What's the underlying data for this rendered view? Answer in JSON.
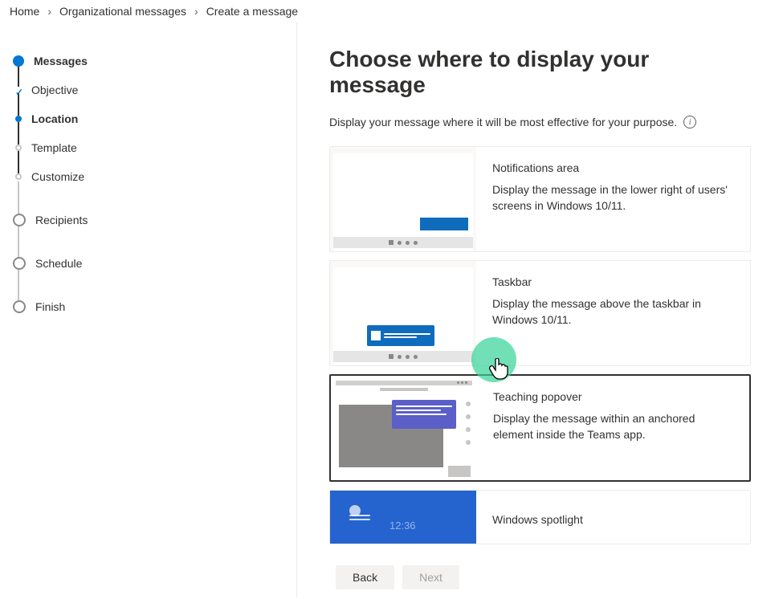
{
  "breadcrumb": {
    "items": [
      {
        "label": "Home"
      },
      {
        "label": "Organizational messages"
      },
      {
        "label": "Create a message"
      }
    ]
  },
  "stepper": {
    "items": [
      {
        "label": "Messages"
      },
      {
        "label": "Objective"
      },
      {
        "label": "Location"
      },
      {
        "label": "Template"
      },
      {
        "label": "Customize"
      },
      {
        "label": "Recipients"
      },
      {
        "label": "Schedule"
      },
      {
        "label": "Finish"
      }
    ]
  },
  "page": {
    "title": "Choose where to display your message",
    "subtitle": "Display your message where it will be most effective for your purpose."
  },
  "options": {
    "notifications": {
      "title": "Notifications area",
      "desc": "Display the message in the lower right of users' screens in Windows 10/11."
    },
    "taskbar": {
      "title": "Taskbar",
      "desc": "Display the message above the taskbar in Windows 10/11."
    },
    "teaching": {
      "title": "Teaching popover",
      "desc": "Display the message within an anchored element inside the Teams app."
    },
    "spotlight": {
      "title": "Windows spotlight",
      "time": "12:36"
    }
  },
  "footer": {
    "back": "Back",
    "next": "Next"
  }
}
